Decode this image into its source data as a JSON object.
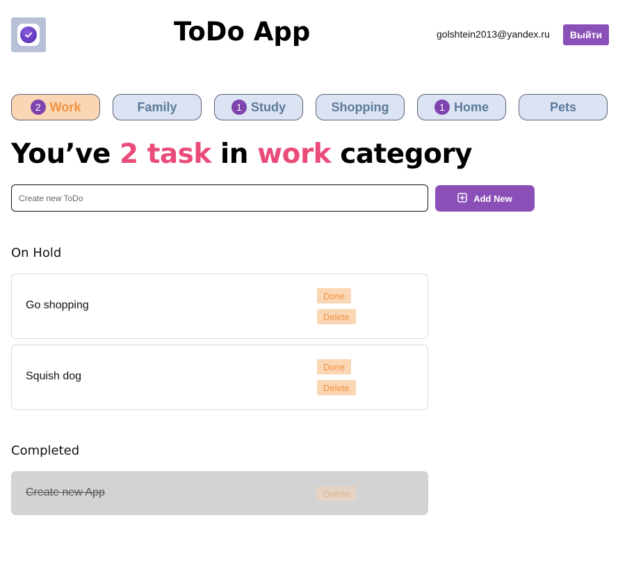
{
  "header": {
    "title": "ToDo App",
    "email": "golshtein2013@yandex.ru",
    "logout_label": "Выйти"
  },
  "categories": [
    {
      "label": "Work",
      "count": "2",
      "active": true
    },
    {
      "label": "Family",
      "count": "",
      "active": false
    },
    {
      "label": "Study",
      "count": "1",
      "active": false
    },
    {
      "label": "Shopping",
      "count": "",
      "active": false
    },
    {
      "label": "Home",
      "count": "1",
      "active": false
    },
    {
      "label": "Pets",
      "count": "",
      "active": false
    }
  ],
  "headline": {
    "prefix": "You’ve ",
    "count_text": "2 task",
    "middle": " in ",
    "category": "work",
    "suffix": " category"
  },
  "new_todo": {
    "placeholder": "Create new ToDo",
    "value": "",
    "add_label": "Add New"
  },
  "on_hold": {
    "title": "On Hold",
    "tasks": [
      {
        "text": "Go shopping",
        "done_label": "Done",
        "delete_label": "Delete"
      },
      {
        "text": "Squish dog",
        "done_label": "Done",
        "delete_label": "Delete"
      }
    ]
  },
  "completed": {
    "title": "Completed",
    "tasks": [
      {
        "text": "Create new App",
        "delete_label": "Delete"
      }
    ]
  },
  "colors": {
    "accent": "#8b4fb8",
    "highlight": "#ea4c7a",
    "active_tab_bg": "#fbd6b5",
    "active_tab_text": "#f0923f",
    "tab_bg": "#dce3f2",
    "tab_text": "#5b7a9c",
    "badge": "#7f43ad",
    "completed_bg": "#d3d3d3"
  },
  "icons": {
    "logo": "check-circle-icon",
    "add": "plus-square-icon"
  }
}
